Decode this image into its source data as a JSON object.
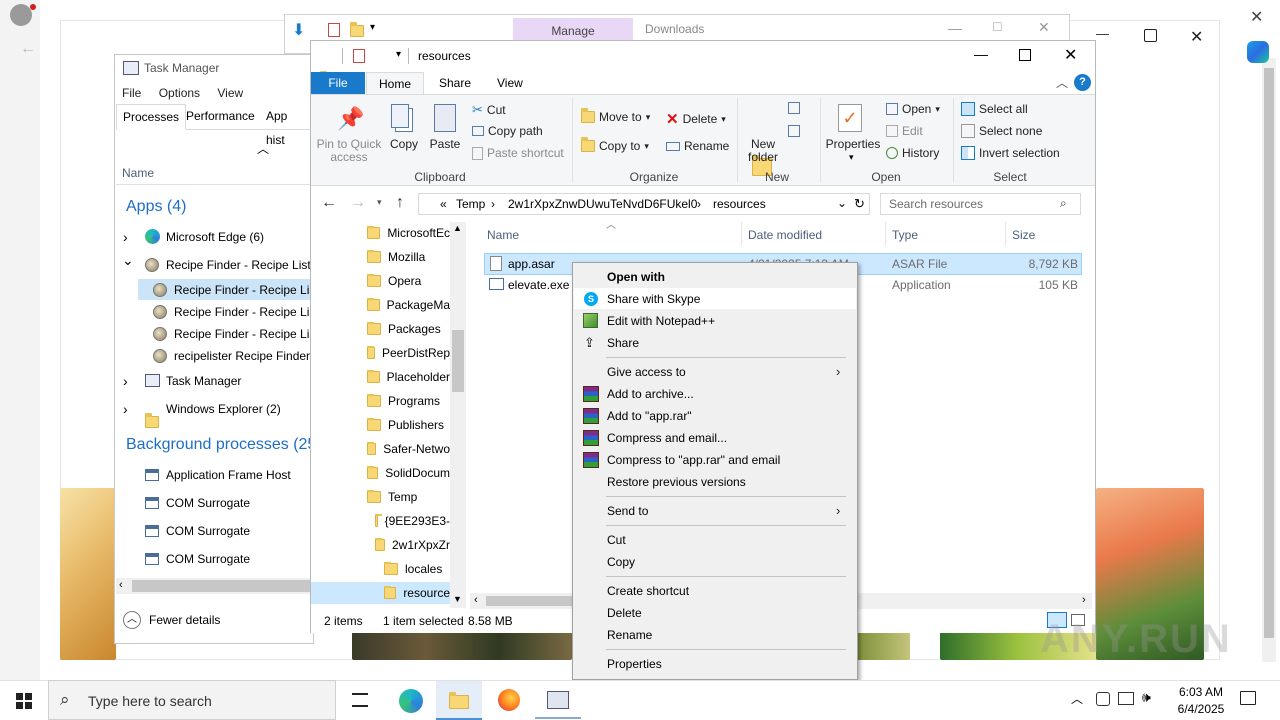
{
  "background": {
    "browser_close": "✕",
    "browser_minimize": "—",
    "browser_maximize": "□"
  },
  "downloads_window": {
    "manage_label": "Manage",
    "title": "Downloads"
  },
  "task_manager": {
    "title": "Task Manager",
    "menu": [
      "File",
      "Options",
      "View"
    ],
    "tabs": [
      "Processes",
      "Performance",
      "App hist"
    ],
    "name_header": "Name",
    "apps_group": "Apps (4)",
    "rows": [
      {
        "label": "Microsoft Edge (6)",
        "expand": "›"
      },
      {
        "label": "Recipe Finder - Recipe Liste",
        "expand": "⌄"
      },
      {
        "label": "Recipe Finder - Recipe Lis"
      },
      {
        "label": "Recipe Finder - Recipe Lis"
      },
      {
        "label": "Recipe Finder - Recipe Lis"
      },
      {
        "label": "recipelister Recipe Finder"
      },
      {
        "label": "Task Manager",
        "expand": "›"
      },
      {
        "label": "Windows Explorer (2)",
        "expand": "›"
      }
    ],
    "bg_group": "Background processes (25",
    "bg_rows": [
      "Application Frame Host",
      "COM Surrogate",
      "COM Surrogate",
      "COM Surrogate"
    ],
    "fewer_details": "Fewer details"
  },
  "explorer": {
    "title": "resources",
    "tabs": {
      "file": "File",
      "home": "Home",
      "share": "Share",
      "view": "View"
    },
    "ribbon": {
      "pin": "Pin to Quick access",
      "copy": "Copy",
      "paste": "Paste",
      "cut": "Cut",
      "copy_path": "Copy path",
      "paste_shortcut": "Paste shortcut",
      "clipboard": "Clipboard",
      "move_to": "Move to",
      "copy_to": "Copy to",
      "delete": "Delete",
      "rename": "Rename",
      "organize": "Organize",
      "new_folder": "New folder",
      "new": "New",
      "properties": "Properties",
      "open": "Open",
      "edit": "Edit",
      "history": "History",
      "open_group": "Open",
      "select_all": "Select all",
      "select_none": "Select none",
      "invert_selection": "Invert selection",
      "select_group": "Select"
    },
    "address": {
      "overflow": "«",
      "crumbs": [
        "Temp",
        "2w1rXpxZnwDUwuTeNvdD6FUkel0",
        "resources"
      ],
      "search_placeholder": "Search resources"
    },
    "nav_items": [
      {
        "label": "MicrosoftEc",
        "indent": 0
      },
      {
        "label": "Mozilla",
        "indent": 0
      },
      {
        "label": "Opera",
        "indent": 0
      },
      {
        "label": "PackageMa",
        "indent": 0
      },
      {
        "label": "Packages",
        "indent": 0
      },
      {
        "label": "PeerDistRep",
        "indent": 0
      },
      {
        "label": "Placeholder",
        "indent": 0
      },
      {
        "label": "Programs",
        "indent": 0
      },
      {
        "label": "Publishers",
        "indent": 0
      },
      {
        "label": "Safer-Netwo",
        "indent": 0
      },
      {
        "label": "SolidDocum",
        "indent": 0
      },
      {
        "label": "Temp",
        "indent": 0
      },
      {
        "label": "{9EE293E3-",
        "indent": 1
      },
      {
        "label": "2w1rXpxZr",
        "indent": 1
      },
      {
        "label": "locales",
        "indent": 2
      },
      {
        "label": "resource",
        "indent": 2
      }
    ],
    "columns": {
      "name": "Name",
      "date": "Date modified",
      "type": "Type",
      "size": "Size"
    },
    "files": [
      {
        "name": "app.asar",
        "date": "4/21/2025 7:13 AM",
        "type": "ASAR File",
        "size": "8,792 KB"
      },
      {
        "name": "elevate.exe",
        "date": "",
        "type": "Application",
        "size": "105 KB"
      }
    ],
    "status": {
      "items": "2 items",
      "selected": "1 item selected",
      "size": "8.58 MB"
    }
  },
  "context_menu": {
    "items": [
      {
        "label": "Open with",
        "bold": true
      },
      {
        "label": "Share with Skype"
      },
      {
        "label": "Edit with Notepad++"
      },
      {
        "label": "Share"
      },
      {
        "label": "Give access to",
        "submenu": true
      },
      {
        "label": "Add to archive..."
      },
      {
        "label": "Add to \"app.rar\""
      },
      {
        "label": "Compress and email..."
      },
      {
        "label": "Compress to \"app.rar\" and email"
      },
      {
        "label": "Restore previous versions"
      },
      {
        "label": "Send to",
        "submenu": true
      },
      {
        "label": "Cut"
      },
      {
        "label": "Copy"
      },
      {
        "label": "Create shortcut"
      },
      {
        "label": "Delete"
      },
      {
        "label": "Rename"
      },
      {
        "label": "Properties"
      }
    ]
  },
  "taskbar": {
    "search_placeholder": "Type here to search",
    "time": "6:03 AM",
    "date": "6/4/2025"
  },
  "watermark": "ANY.RUN",
  "colors": {
    "accent": "#1979ca",
    "selection": "#cce8ff",
    "link_blue": "#1e6ec4",
    "manage_tab": "#e8d7f5"
  }
}
